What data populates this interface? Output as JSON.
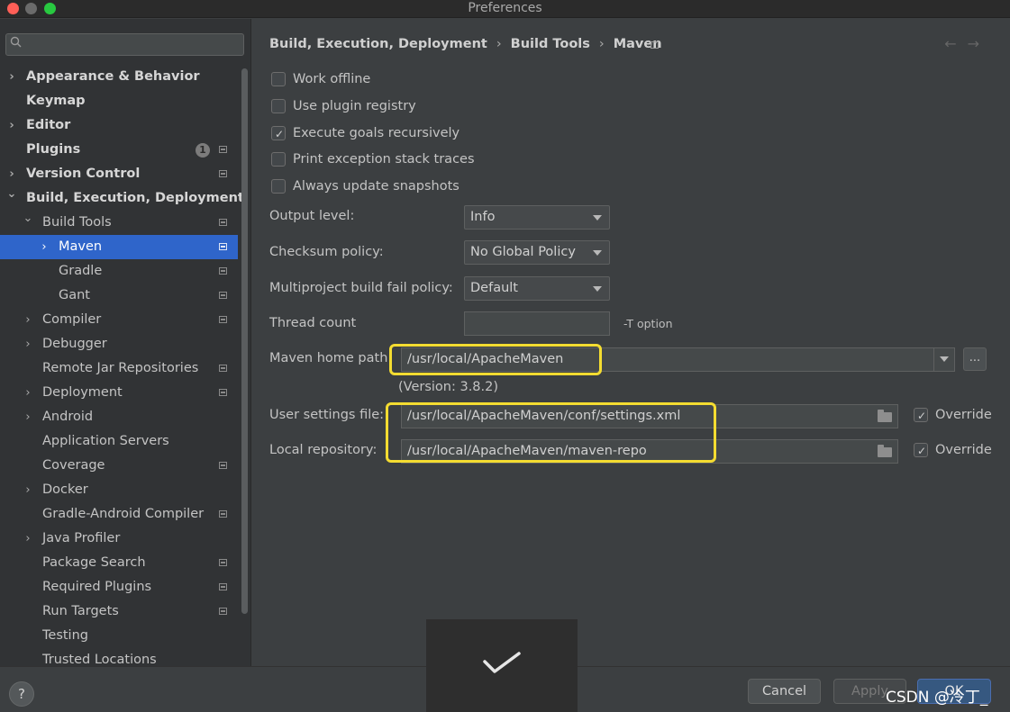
{
  "window": {
    "title": "Preferences"
  },
  "sidebar": {
    "search_placeholder": "Q",
    "items": [
      {
        "label": "Appearance & Behavior",
        "bold": true,
        "chevron": "right",
        "level": 0,
        "page_icon": false
      },
      {
        "label": "Keymap",
        "bold": true,
        "chevron": "none",
        "level": 0,
        "page_icon": false
      },
      {
        "label": "Editor",
        "bold": true,
        "chevron": "right",
        "level": 0,
        "page_icon": false
      },
      {
        "label": "Plugins",
        "bold": true,
        "chevron": "none",
        "level": 0,
        "page_icon": true,
        "badge": "1"
      },
      {
        "label": "Version Control",
        "bold": true,
        "chevron": "right",
        "level": 0,
        "page_icon": true
      },
      {
        "label": "Build, Execution, Deployment",
        "bold": true,
        "chevron": "down",
        "level": 0,
        "page_icon": false
      },
      {
        "label": "Build Tools",
        "bold": false,
        "chevron": "down",
        "level": 1,
        "page_icon": true
      },
      {
        "label": "Maven",
        "bold": false,
        "chevron": "right",
        "level": 2,
        "page_icon": true,
        "selected": true
      },
      {
        "label": "Gradle",
        "bold": false,
        "chevron": "none",
        "level": 2,
        "page_icon": true
      },
      {
        "label": "Gant",
        "bold": false,
        "chevron": "none",
        "level": 2,
        "page_icon": true
      },
      {
        "label": "Compiler",
        "bold": false,
        "chevron": "right",
        "level": 1,
        "page_icon": true
      },
      {
        "label": "Debugger",
        "bold": false,
        "chevron": "right",
        "level": 1,
        "page_icon": false
      },
      {
        "label": "Remote Jar Repositories",
        "bold": false,
        "chevron": "none",
        "level": 1,
        "page_icon": true
      },
      {
        "label": "Deployment",
        "bold": false,
        "chevron": "right",
        "level": 1,
        "page_icon": true
      },
      {
        "label": "Android",
        "bold": false,
        "chevron": "right",
        "level": 1,
        "page_icon": false
      },
      {
        "label": "Application Servers",
        "bold": false,
        "chevron": "none",
        "level": 1,
        "page_icon": false
      },
      {
        "label": "Coverage",
        "bold": false,
        "chevron": "none",
        "level": 1,
        "page_icon": true
      },
      {
        "label": "Docker",
        "bold": false,
        "chevron": "right",
        "level": 1,
        "page_icon": false
      },
      {
        "label": "Gradle-Android Compiler",
        "bold": false,
        "chevron": "none",
        "level": 1,
        "page_icon": true
      },
      {
        "label": "Java Profiler",
        "bold": false,
        "chevron": "right",
        "level": 1,
        "page_icon": false
      },
      {
        "label": "Package Search",
        "bold": false,
        "chevron": "none",
        "level": 1,
        "page_icon": true
      },
      {
        "label": "Required Plugins",
        "bold": false,
        "chevron": "none",
        "level": 1,
        "page_icon": true
      },
      {
        "label": "Run Targets",
        "bold": false,
        "chevron": "none",
        "level": 1,
        "page_icon": true
      },
      {
        "label": "Testing",
        "bold": false,
        "chevron": "none",
        "level": 1,
        "page_icon": false
      },
      {
        "label": "Trusted Locations",
        "bold": false,
        "chevron": "none",
        "level": 1,
        "page_icon": false
      }
    ]
  },
  "breadcrumb": {
    "items": [
      "Build, Execution, Deployment",
      "Build Tools",
      "Maven"
    ],
    "separator": "›"
  },
  "nav": {
    "back": "←",
    "forward": "→"
  },
  "options": {
    "work_offline": {
      "label": "Work offline",
      "checked": false
    },
    "plugin_registry": {
      "label": "Use plugin registry",
      "checked": false
    },
    "goals_recursively": {
      "label": "Execute goals recursively",
      "checked": true
    },
    "exception_traces": {
      "label": "Print exception stack traces",
      "checked": false
    },
    "update_snapshots": {
      "label": "Always update snapshots",
      "checked": false
    }
  },
  "fields": {
    "output_level": {
      "label": "Output level:",
      "value": "Info"
    },
    "checksum_policy": {
      "label": "Checksum policy:",
      "value": "No Global Policy"
    },
    "fail_policy": {
      "label": "Multiproject build fail policy:",
      "value": "Default"
    },
    "thread_count": {
      "label": "Thread count",
      "value": "",
      "hint": "-T option"
    },
    "maven_home": {
      "label": "Maven home path:",
      "value": "/usr/local/ApacheMaven",
      "browse": "...",
      "version": "(Version: 3.8.2)"
    },
    "user_settings": {
      "label": "User settings file:",
      "value": "/usr/local/ApacheMaven/conf/settings.xml",
      "override_label": "Override",
      "override_checked": true
    },
    "local_repo": {
      "label": "Local repository:",
      "value": "/usr/local/ApacheMaven/maven-repo",
      "override_label": "Override",
      "override_checked": true
    }
  },
  "footer": {
    "help": "?",
    "cancel": "Cancel",
    "apply": "Apply",
    "ok": "OK",
    "watermark": "CSDN @冷丁_"
  },
  "colors": {
    "highlight": "#f4dc31",
    "selection": "#2f65ca",
    "ok_button": "#365880"
  },
  "icons": {
    "check": "check-icon",
    "folder": "folder-icon",
    "search": "search-icon"
  }
}
